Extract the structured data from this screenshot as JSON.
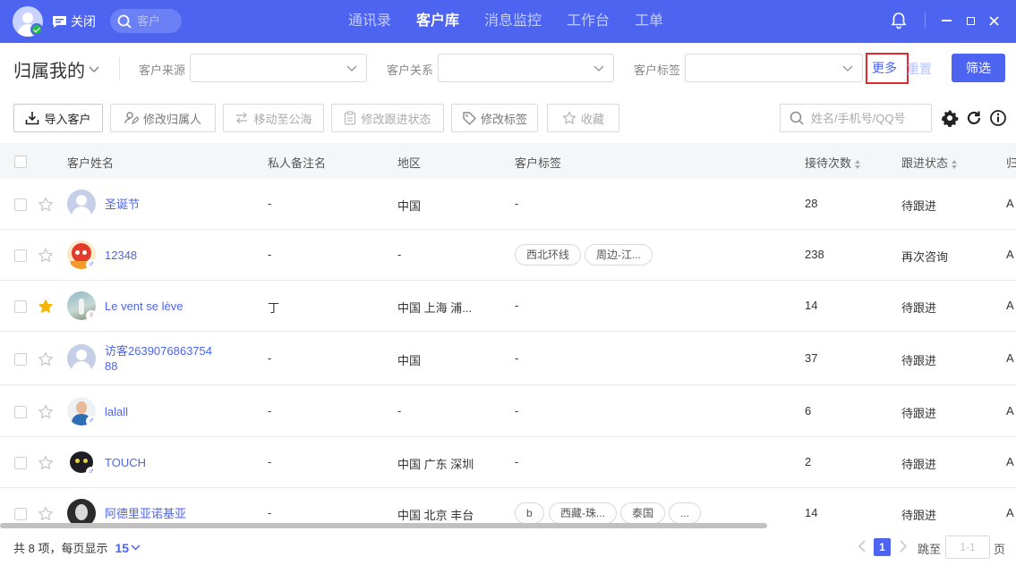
{
  "topbar": {
    "close_label": "关闭",
    "search_placeholder": "客户",
    "nav": [
      "通讯录",
      "客户库",
      "消息监控",
      "工作台",
      "工单"
    ],
    "active_nav": 1
  },
  "filters": {
    "owner": "归属我的",
    "source_label": "客户来源",
    "relation_label": "客户关系",
    "tag_label": "客户标签",
    "more": "更多",
    "reset": "重置",
    "apply": "筛选"
  },
  "toolbar": {
    "import": "导入客户",
    "change_owner": "修改归属人",
    "move_to_pool": "移动至公海",
    "change_status": "修改跟进状态",
    "change_tags": "修改标签",
    "favorite": "收藏",
    "search_placeholder": "姓名/手机号/QQ号"
  },
  "table": {
    "headers": {
      "name": "客户姓名",
      "remark": "私人备注名",
      "region": "地区",
      "tags": "客户标签",
      "visits": "接待次数",
      "status": "跟进状态",
      "owner_trunc": "归"
    },
    "rows": [
      {
        "name": "圣诞节",
        "remark": "-",
        "region": "中国",
        "tags": [],
        "tags_text": "-",
        "visits": "28",
        "status": "待跟进",
        "owner": "A",
        "starred": false,
        "sex": ""
      },
      {
        "name": "12348",
        "remark": "-",
        "region": "-",
        "tags": [
          "西北环线",
          "周边-江..."
        ],
        "tags_text": "",
        "visits": "238",
        "status": "再次咨询",
        "owner": "A",
        "starred": false,
        "sex": "♂"
      },
      {
        "name": "Le vent se lève",
        "remark": "丁",
        "region": "中国 上海 浦...",
        "tags": [],
        "tags_text": "-",
        "visits": "14",
        "status": "待跟进",
        "owner": "A",
        "starred": true,
        "sex": "♀"
      },
      {
        "name_line1": "访客2639076863754",
        "name_line2": "88",
        "remark": "-",
        "region": "中国",
        "tags": [],
        "tags_text": "-",
        "visits": "37",
        "status": "待跟进",
        "owner": "A",
        "starred": false,
        "sex": ""
      },
      {
        "name": "lalall",
        "remark": "-",
        "region": "-",
        "tags": [],
        "tags_text": "-",
        "visits": "6",
        "status": "待跟进",
        "owner": "A",
        "starred": false,
        "sex": "♂"
      },
      {
        "name": "TOUCH",
        "remark": "-",
        "region": "中国 广东 深圳",
        "tags": [],
        "tags_text": "-",
        "visits": "2",
        "status": "待跟进",
        "owner": "A",
        "starred": false,
        "sex": "♂"
      },
      {
        "name": "阿德里亚诺基亚",
        "remark": "-",
        "region": "中国 北京 丰台",
        "tags": [
          "b",
          "西藏-珠...",
          "泰国",
          "..."
        ],
        "tags_text": "",
        "visits": "14",
        "status": "待跟进",
        "owner": "A",
        "starred": false,
        "sex": ""
      }
    ]
  },
  "footer": {
    "total_text": "共 8 项，每页显示",
    "page_size": "15",
    "current_page": "1",
    "jump_label": "跳至",
    "jump_placeholder": "1-1",
    "page_unit": "页"
  },
  "colors": {
    "primary": "#4c64f0",
    "highlight_border": "#e0282e",
    "star_active": "#f7b500"
  }
}
